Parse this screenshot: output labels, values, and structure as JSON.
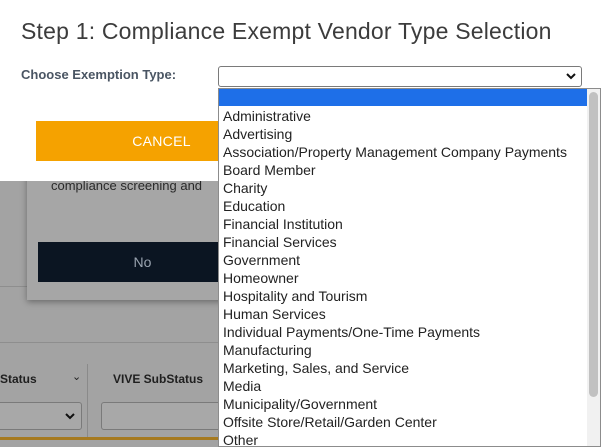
{
  "modal": {
    "title": "Step 1: Compliance Exempt Vendor Type Selection",
    "field_label": "Choose Exemption Type:",
    "select_value": "",
    "cancel_label": "CANCEL"
  },
  "dropdown": {
    "selected_index": 0,
    "options": [
      "",
      "Administrative",
      "Advertising",
      "Association/Property Management Company Payments",
      "Board Member",
      "Charity",
      "Education",
      "Financial Institution",
      "Financial Services",
      "Government",
      "Homeowner",
      "Hospitality and Tourism",
      "Human Services",
      "Individual Payments/One-Time Payments",
      "Manufacturing",
      "Marketing, Sales, and Service",
      "Media",
      "Municipality/Government",
      "Offsite Store/Retail/Garden Center",
      "Other"
    ]
  },
  "background": {
    "confirm_text": "compliance screening and",
    "no_label": "No",
    "filter_status_label": "Status",
    "filter_vive_substatus_label": "VIVE SubStatus"
  },
  "colors": {
    "accent_orange": "#f5a200",
    "selected_blue": "#1e6fe8",
    "dark_button": "#0b1522"
  }
}
